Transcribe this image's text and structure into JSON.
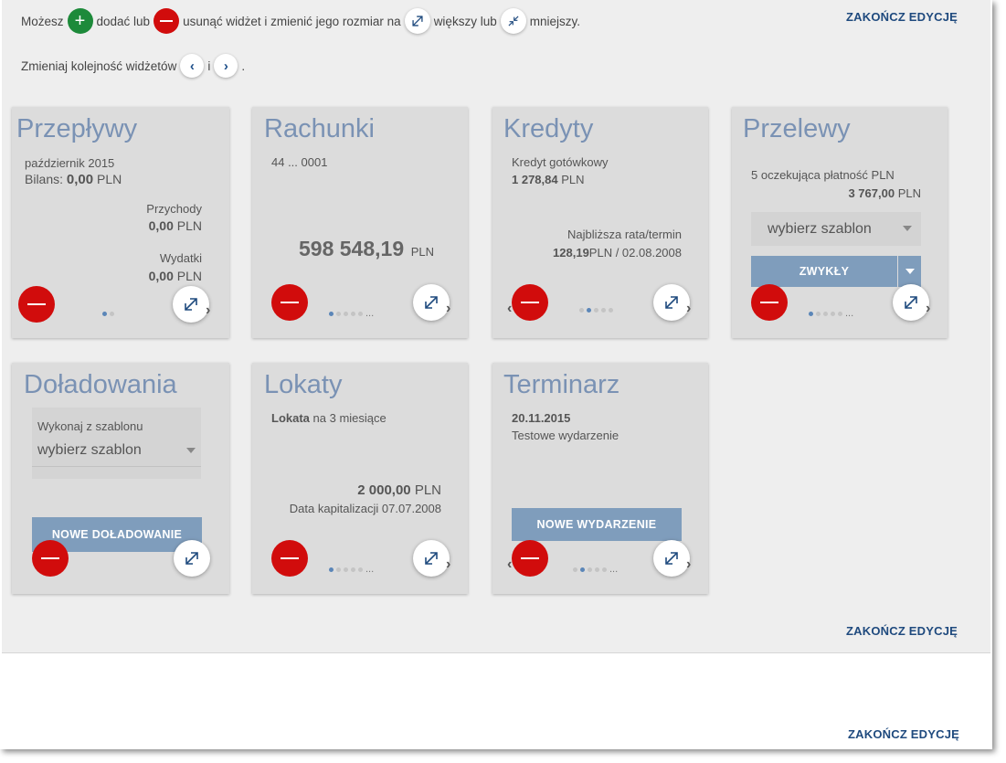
{
  "info": {
    "line1": [
      "Możesz",
      "dodać lub",
      "usunąć widżet i zmienić jego rozmiar na",
      "większy lub",
      "mniejszy."
    ],
    "line2": [
      "Zmieniaj kolejność widżetów",
      "i",
      "."
    ]
  },
  "end_edit_label": "ZAKOŃCZ EDYCJĘ",
  "widgets": {
    "przeplywy": {
      "title": "Przepływy",
      "period": "październik 2015",
      "balance_label": "Bilans:",
      "balance_value": "0,00",
      "currency": "PLN",
      "income_label": "Przychody",
      "income_value": "0,00",
      "expense_label": "Wydatki",
      "expense_value": "0,00"
    },
    "rachunki": {
      "title": "Rachunki",
      "account": "44 ... 0001",
      "amount": "598 548,19",
      "currency": "PLN",
      "more": "..."
    },
    "kredyty": {
      "title": "Kredyty",
      "name": "Kredyt gotówkowy",
      "amount": "1 278,84",
      "currency": "PLN",
      "next_label": "Najbliższa rata/termin",
      "next_amount": "128,19",
      "next_rest": "PLN / 02.08.2008"
    },
    "przelewy": {
      "title": "Przelewy",
      "pending": "5 oczekująca płatność PLN",
      "pending_amount": "3 767,00",
      "currency": "PLN",
      "select_value": "wybierz szablon",
      "button": "ZWYKŁY",
      "more": "..."
    },
    "doladowania": {
      "title": "Doładowania",
      "select_label": "Wykonaj z szablonu",
      "select_value": "wybierz szablon",
      "button": "NOWE DOŁADOWANIE"
    },
    "lokaty": {
      "title": "Lokaty",
      "name_bold": "Lokata",
      "name_rest": "na 3 miesiące",
      "amount": "2 000,00",
      "currency": "PLN",
      "cap_label": "Data kapitalizacji 07.07.2008",
      "more": "..."
    },
    "terminarz": {
      "title": "Terminarz",
      "date": "20.11.2015",
      "event": "Testowe wydarzenie",
      "button": "NOWE WYDARZENIE",
      "more": "..."
    }
  },
  "colors": {
    "title": "#7a92b4",
    "remove": "#d10c0c",
    "add": "#1d8a3a",
    "button": "#7f9dbc",
    "link": "#1f4a7e"
  }
}
